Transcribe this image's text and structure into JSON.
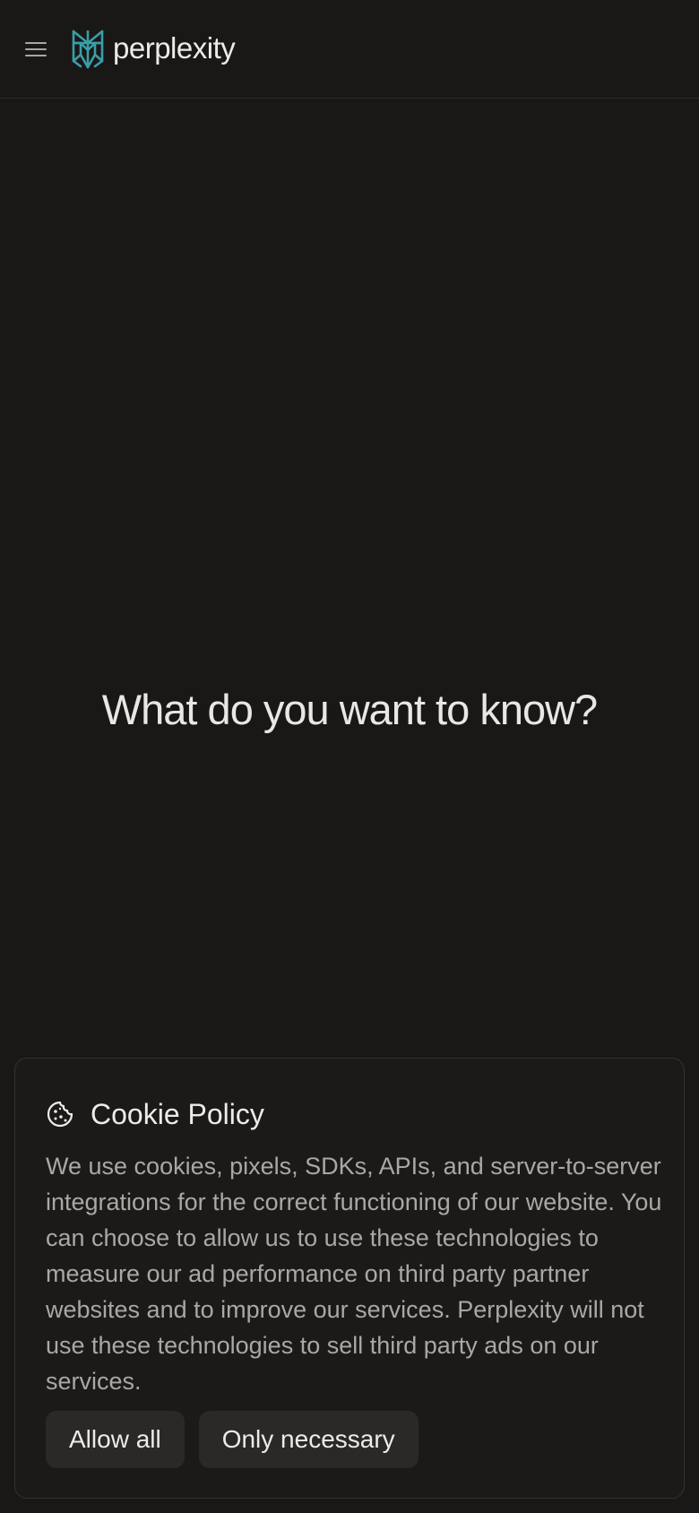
{
  "header": {
    "brand_name": "perplexity",
    "brand_color": "#3a9ea8",
    "menu_icon": "hamburger-menu-icon",
    "logo_icon": "perplexity-logo-icon"
  },
  "hero": {
    "title": "What do you want to know?"
  },
  "cookie_banner": {
    "icon": "cookie-icon",
    "title": "Cookie Policy",
    "body": "We use cookies, pixels, SDKs, APIs, and server-to-server integrations for the correct functioning of our website. You can choose to allow us to use these technologies to measure our ad performance on third party partner websites and to improve our services. Perplexity will not use these technologies to sell third party ads on our services.",
    "allow_all_label": "Allow all",
    "only_necessary_label": "Only necessary"
  }
}
